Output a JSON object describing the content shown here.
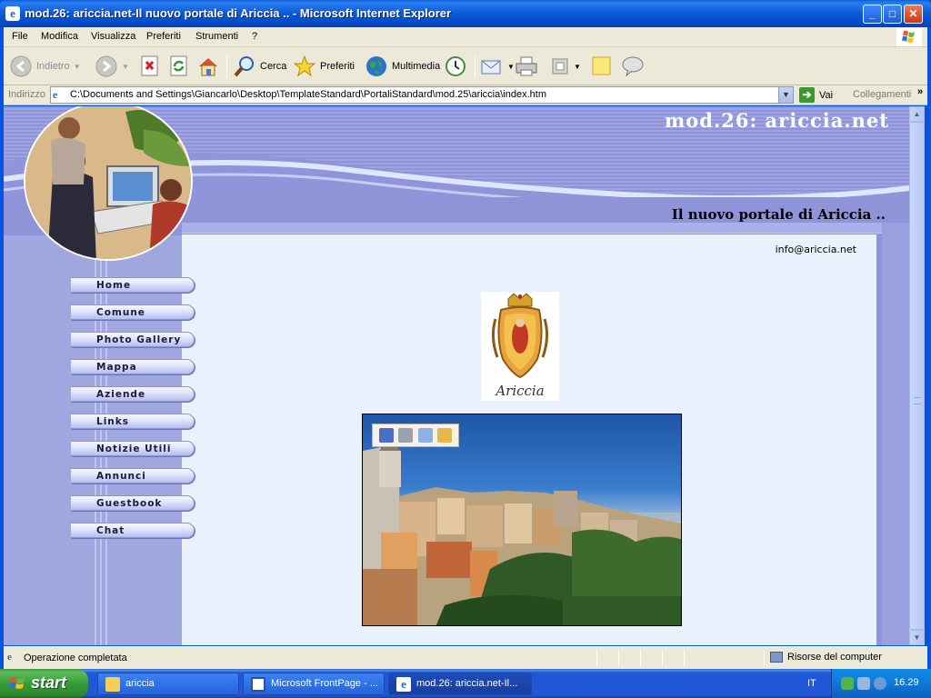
{
  "window": {
    "title": "mod.26: ariccia.net-Il nuovo portale di Ariccia .. - Microsoft Internet Explorer",
    "controls": {
      "minimize": "_",
      "maximize": "□",
      "close": "✕"
    }
  },
  "menubar": {
    "items": [
      "File",
      "Modifica",
      "Visualizza",
      "Preferiti",
      "Strumenti",
      "?"
    ]
  },
  "toolbar": {
    "back": "Indietro",
    "search": "Cerca",
    "favorites": "Preferiti",
    "media": "Multimedia"
  },
  "addressbar": {
    "label": "Indirizzo",
    "url": "C:\\Documents and Settings\\Giancarlo\\Desktop\\TemplateStandard\\PortaliStandard\\mod.25\\ariccia\\index.htm",
    "go": "Vai",
    "links": "Collegamenti",
    "more": "»"
  },
  "page": {
    "site_title": "mod.26:  ariccia.net",
    "subtitle": "Il nuovo portale di Ariccia ..",
    "email": "info@ariccia.net",
    "crest_caption": "Ariccia",
    "nav": [
      "Home",
      "Comune",
      "Photo Gallery",
      "Mappa",
      "Aziende",
      "Links",
      "Notizie Utili",
      "Annunci",
      "Guestbook",
      "Chat"
    ]
  },
  "statusbar": {
    "text": "Operazione completata",
    "zone": "Risorse del computer"
  },
  "taskbar": {
    "start": "start",
    "tasks": [
      "ariccia",
      "Microsoft FrontPage - ...",
      "mod.26: ariccia.net-Il..."
    ],
    "lang": "IT",
    "clock": "16.29"
  }
}
